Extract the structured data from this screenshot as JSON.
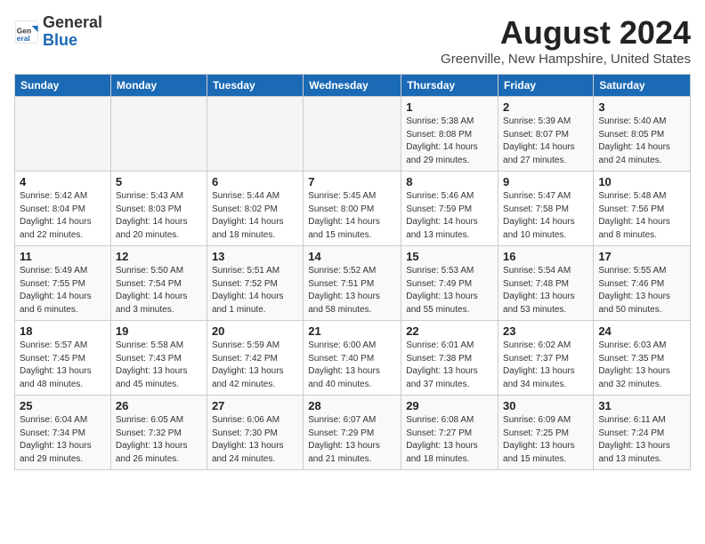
{
  "header": {
    "logo_general": "General",
    "logo_blue": "Blue",
    "title": "August 2024",
    "subtitle": "Greenville, New Hampshire, United States"
  },
  "days": [
    "Sunday",
    "Monday",
    "Tuesday",
    "Wednesday",
    "Thursday",
    "Friday",
    "Saturday"
  ],
  "weeks": [
    [
      {
        "date": "",
        "info": ""
      },
      {
        "date": "",
        "info": ""
      },
      {
        "date": "",
        "info": ""
      },
      {
        "date": "",
        "info": ""
      },
      {
        "date": "1",
        "info": "Sunrise: 5:38 AM\nSunset: 8:08 PM\nDaylight: 14 hours\nand 29 minutes."
      },
      {
        "date": "2",
        "info": "Sunrise: 5:39 AM\nSunset: 8:07 PM\nDaylight: 14 hours\nand 27 minutes."
      },
      {
        "date": "3",
        "info": "Sunrise: 5:40 AM\nSunset: 8:05 PM\nDaylight: 14 hours\nand 24 minutes."
      }
    ],
    [
      {
        "date": "4",
        "info": "Sunrise: 5:42 AM\nSunset: 8:04 PM\nDaylight: 14 hours\nand 22 minutes."
      },
      {
        "date": "5",
        "info": "Sunrise: 5:43 AM\nSunset: 8:03 PM\nDaylight: 14 hours\nand 20 minutes."
      },
      {
        "date": "6",
        "info": "Sunrise: 5:44 AM\nSunset: 8:02 PM\nDaylight: 14 hours\nand 18 minutes."
      },
      {
        "date": "7",
        "info": "Sunrise: 5:45 AM\nSunset: 8:00 PM\nDaylight: 14 hours\nand 15 minutes."
      },
      {
        "date": "8",
        "info": "Sunrise: 5:46 AM\nSunset: 7:59 PM\nDaylight: 14 hours\nand 13 minutes."
      },
      {
        "date": "9",
        "info": "Sunrise: 5:47 AM\nSunset: 7:58 PM\nDaylight: 14 hours\nand 10 minutes."
      },
      {
        "date": "10",
        "info": "Sunrise: 5:48 AM\nSunset: 7:56 PM\nDaylight: 14 hours\nand 8 minutes."
      }
    ],
    [
      {
        "date": "11",
        "info": "Sunrise: 5:49 AM\nSunset: 7:55 PM\nDaylight: 14 hours\nand 6 minutes."
      },
      {
        "date": "12",
        "info": "Sunrise: 5:50 AM\nSunset: 7:54 PM\nDaylight: 14 hours\nand 3 minutes."
      },
      {
        "date": "13",
        "info": "Sunrise: 5:51 AM\nSunset: 7:52 PM\nDaylight: 14 hours\nand 1 minute."
      },
      {
        "date": "14",
        "info": "Sunrise: 5:52 AM\nSunset: 7:51 PM\nDaylight: 13 hours\nand 58 minutes."
      },
      {
        "date": "15",
        "info": "Sunrise: 5:53 AM\nSunset: 7:49 PM\nDaylight: 13 hours\nand 55 minutes."
      },
      {
        "date": "16",
        "info": "Sunrise: 5:54 AM\nSunset: 7:48 PM\nDaylight: 13 hours\nand 53 minutes."
      },
      {
        "date": "17",
        "info": "Sunrise: 5:55 AM\nSunset: 7:46 PM\nDaylight: 13 hours\nand 50 minutes."
      }
    ],
    [
      {
        "date": "18",
        "info": "Sunrise: 5:57 AM\nSunset: 7:45 PM\nDaylight: 13 hours\nand 48 minutes."
      },
      {
        "date": "19",
        "info": "Sunrise: 5:58 AM\nSunset: 7:43 PM\nDaylight: 13 hours\nand 45 minutes."
      },
      {
        "date": "20",
        "info": "Sunrise: 5:59 AM\nSunset: 7:42 PM\nDaylight: 13 hours\nand 42 minutes."
      },
      {
        "date": "21",
        "info": "Sunrise: 6:00 AM\nSunset: 7:40 PM\nDaylight: 13 hours\nand 40 minutes."
      },
      {
        "date": "22",
        "info": "Sunrise: 6:01 AM\nSunset: 7:38 PM\nDaylight: 13 hours\nand 37 minutes."
      },
      {
        "date": "23",
        "info": "Sunrise: 6:02 AM\nSunset: 7:37 PM\nDaylight: 13 hours\nand 34 minutes."
      },
      {
        "date": "24",
        "info": "Sunrise: 6:03 AM\nSunset: 7:35 PM\nDaylight: 13 hours\nand 32 minutes."
      }
    ],
    [
      {
        "date": "25",
        "info": "Sunrise: 6:04 AM\nSunset: 7:34 PM\nDaylight: 13 hours\nand 29 minutes."
      },
      {
        "date": "26",
        "info": "Sunrise: 6:05 AM\nSunset: 7:32 PM\nDaylight: 13 hours\nand 26 minutes."
      },
      {
        "date": "27",
        "info": "Sunrise: 6:06 AM\nSunset: 7:30 PM\nDaylight: 13 hours\nand 24 minutes."
      },
      {
        "date": "28",
        "info": "Sunrise: 6:07 AM\nSunset: 7:29 PM\nDaylight: 13 hours\nand 21 minutes."
      },
      {
        "date": "29",
        "info": "Sunrise: 6:08 AM\nSunset: 7:27 PM\nDaylight: 13 hours\nand 18 minutes."
      },
      {
        "date": "30",
        "info": "Sunrise: 6:09 AM\nSunset: 7:25 PM\nDaylight: 13 hours\nand 15 minutes."
      },
      {
        "date": "31",
        "info": "Sunrise: 6:11 AM\nSunset: 7:24 PM\nDaylight: 13 hours\nand 13 minutes."
      }
    ]
  ]
}
